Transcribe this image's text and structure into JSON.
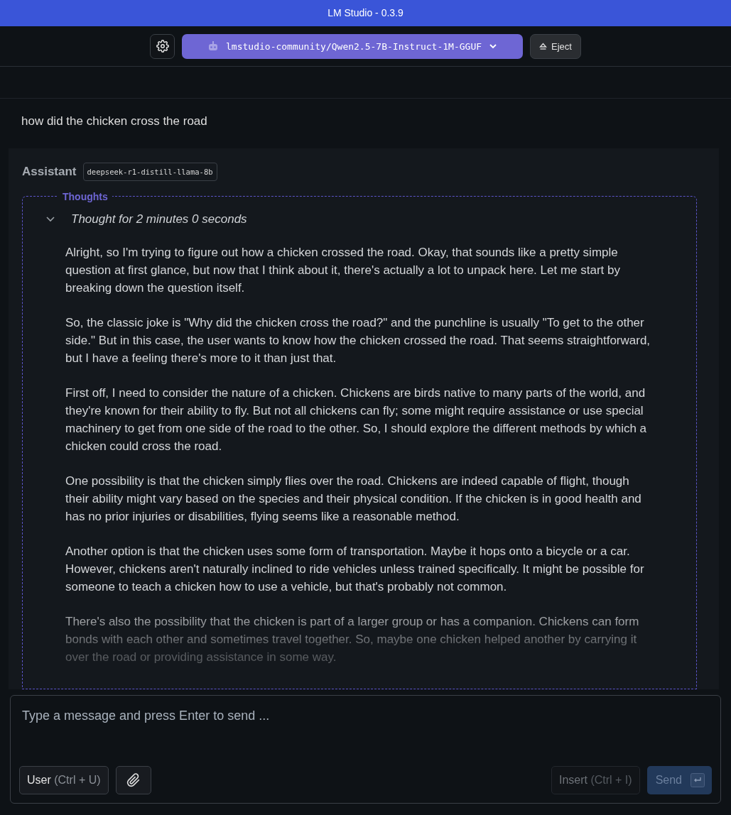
{
  "window": {
    "title": "LM Studio - 0.3.9"
  },
  "toolbar": {
    "model": "lmstudio-community/Qwen2.5-7B-Instruct-1M-GGUF",
    "eject": "Eject"
  },
  "user_message": "how did the chicken cross the road",
  "assistant": {
    "role": "Assistant",
    "model_tag": "deepseek-r1-distill-llama-8b",
    "thoughts": {
      "legend": "Thoughts",
      "summary": "Thought for 2 minutes 0 seconds",
      "expanded": true,
      "paragraphs": [
        "Alright, so I'm trying to figure out how a chicken crossed the road. Okay, that sounds like a pretty simple question at first glance, but now that I think about it, there's actually a lot to unpack here. Let me start by breaking down the question itself.",
        "So, the classic joke is \"Why did the chicken cross the road?\" and the punchline is usually \"To get to the other side.\" But in this case, the user wants to know how the chicken crossed the road. That seems straightforward, but I have a feeling there's more to it than just that.",
        "First off, I need to consider the nature of a chicken. Chickens are birds native to many parts of the world, and they're known for their ability to fly. But not all chickens can fly; some might require assistance or use special machinery to get from one side of the road to the other. So, I should explore the different methods by which a chicken could cross the road.",
        "One possibility is that the chicken simply flies over the road. Chickens are indeed capable of flight, though their ability might vary based on the species and their physical condition. If the chicken is in good health and has no prior injuries or disabilities, flying seems like a reasonable method.",
        "Another option is that the chicken uses some form of transportation. Maybe it hops onto a bicycle or a car. However, chickens aren't naturally inclined to ride vehicles unless trained specifically. It might be possible for someone to teach a chicken how to use a vehicle, but that's probably not common.",
        "There's also the possibility that the chicken is part of a larger group or has a companion. Chickens can form bonds with each other and sometimes travel together. So, maybe one chicken helped another by carrying it over the road or providing assistance in some way."
      ]
    }
  },
  "composer": {
    "placeholder": "Type a message and press Enter to send ...",
    "role_button": {
      "label": "User",
      "shortcut": "(Ctrl + U)"
    },
    "insert_button": {
      "label": "Insert",
      "shortcut": "(Ctrl + I)",
      "disabled": true
    },
    "send_button": {
      "label": "Send",
      "disabled": true
    }
  }
}
